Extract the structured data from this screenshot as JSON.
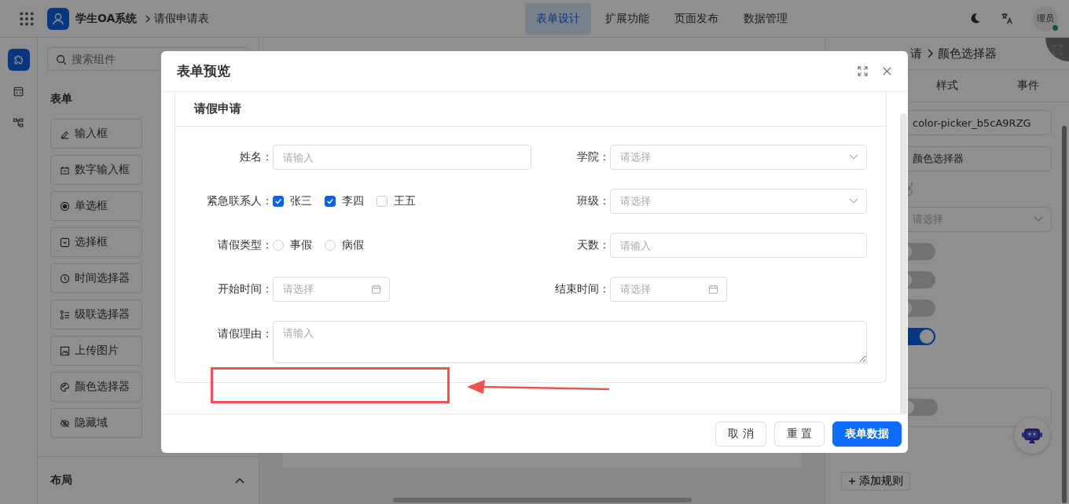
{
  "header": {
    "app_name": "学生OA系统",
    "page": "请假申请表",
    "nav": [
      {
        "label": "表单设计",
        "selected": true
      },
      {
        "label": "扩展功能",
        "selected": false
      },
      {
        "label": "页面发布",
        "selected": false
      },
      {
        "label": "数据管理",
        "selected": false
      }
    ],
    "avatar": "理员"
  },
  "rail": [
    {
      "kind": "puzzle",
      "selected": true
    },
    {
      "kind": "code",
      "selected": false
    },
    {
      "kind": "tree",
      "selected": false
    }
  ],
  "components_panel": {
    "search": {
      "placeholder": "搜索组件"
    },
    "section": "表单",
    "items": [
      {
        "label": "输入框",
        "kind": "pen"
      },
      {
        "label": "数字输入框",
        "kind": "number"
      },
      {
        "label": "单选框",
        "kind": "radio"
      },
      {
        "label": "选择框",
        "kind": "select"
      },
      {
        "label": "时间选择器",
        "kind": "clock"
      },
      {
        "label": "级联选择器",
        "kind": "cascade"
      },
      {
        "label": "上传图片",
        "kind": "image"
      },
      {
        "label": "颜色选择器",
        "kind": "palette"
      },
      {
        "label": "隐藏域",
        "kind": "eye-off"
      }
    ],
    "layout_section": "布局"
  },
  "properties_panel": {
    "breadcrumb": [
      "请",
      "颜色选择器"
    ],
    "tabs": [
      "样式",
      "事件"
    ],
    "field_id": "color-picker_b5cA9RZG",
    "field_label": "颜色选择器",
    "select": {
      "placeholder": "请选择"
    },
    "switches": [
      {
        "on": false
      },
      {
        "on": false
      },
      {
        "on": false
      },
      {
        "on": true
      }
    ],
    "rule_switch": {
      "on": false
    },
    "add_rule": "添加规则"
  },
  "dialog": {
    "title": "表单预览",
    "form_title": "请假申请",
    "fields": [
      {
        "label": "姓名：",
        "kind": "input",
        "placeholder": "请输入"
      },
      {
        "label": "学院：",
        "kind": "select",
        "placeholder": "请选择"
      },
      {
        "label": "紧急联系人：",
        "kind": "checkbox",
        "options": [
          {
            "label": "张三",
            "checked": true
          },
          {
            "label": "李四",
            "checked": true
          },
          {
            "label": "王五",
            "checked": false
          }
        ]
      },
      {
        "label": "班级：",
        "kind": "select",
        "placeholder": "请选择"
      },
      {
        "label": "请假类型：",
        "kind": "radio",
        "options": [
          {
            "label": "事假",
            "selected": false
          },
          {
            "label": "病假",
            "selected": false
          }
        ]
      },
      {
        "label": "天数：",
        "kind": "input",
        "placeholder": "请输入"
      },
      {
        "label": "开始时间：",
        "kind": "date",
        "placeholder": "请选择"
      },
      {
        "label": "结束时间：",
        "kind": "date",
        "placeholder": "请选择"
      },
      {
        "label": "请假理由：",
        "kind": "textarea",
        "placeholder": "请输入"
      }
    ],
    "buttons": [
      {
        "label": "取 消",
        "kind": "default"
      },
      {
        "label": "重 置",
        "kind": "default"
      },
      {
        "label": "表单数据",
        "kind": "primary"
      }
    ]
  }
}
